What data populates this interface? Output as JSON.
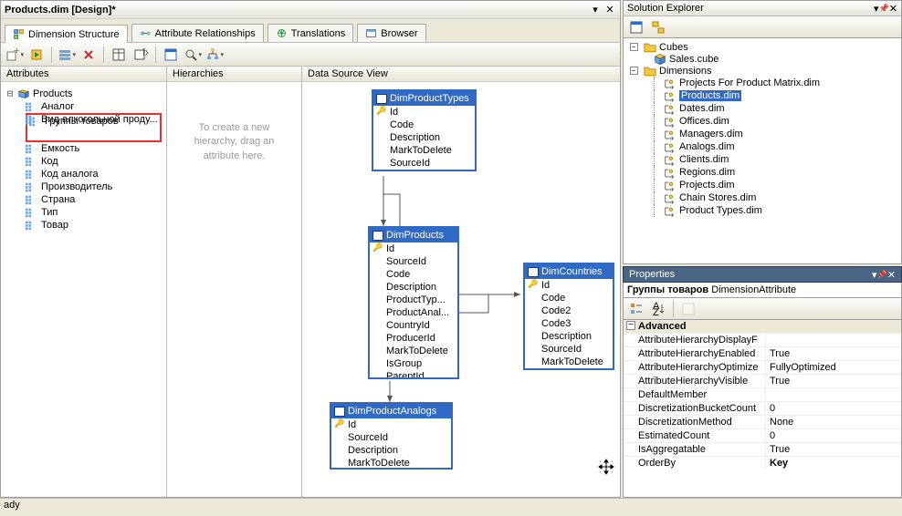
{
  "title": "Products.dim [Design]*",
  "tabs": [
    {
      "label": "Dimension Structure"
    },
    {
      "label": "Attribute Relationships"
    },
    {
      "label": "Translations"
    },
    {
      "label": "Browser"
    }
  ],
  "panes": {
    "attributes": "Attributes",
    "hierarchies": "Hierarchies",
    "dsv": "Data Source View"
  },
  "attr_root": "Products",
  "attributes": [
    "Аналог",
    "Вид алкогольной проду...",
    "Группы товаров",
    "Емкость",
    "Код",
    "Код аналога",
    "Производитель",
    "Страна",
    "Тип",
    "Товар"
  ],
  "hier_hint": "To create a new hierarchy, drag an attribute here.",
  "dsv_tables": {
    "DimProductTypes": {
      "name": "DimProductTypes",
      "cols": [
        "Id",
        "Code",
        "Description",
        "MarkToDelete",
        "SourceId"
      ]
    },
    "DimProducts": {
      "name": "DimProducts",
      "cols": [
        "Id",
        "SourceId",
        "Code",
        "Description",
        "ProductTyp...",
        "ProductAnal...",
        "CountryId",
        "ProducerId",
        "MarkToDelete",
        "IsGroup",
        "ParentId"
      ]
    },
    "DimCountries": {
      "name": "DimCountries",
      "cols": [
        "Id",
        "Code",
        "Code2",
        "Code3",
        "Description",
        "SourceId",
        "MarkToDelete"
      ]
    },
    "DimProductAnalogs": {
      "name": "DimProductAnalogs",
      "cols": [
        "Id",
        "SourceId",
        "Description",
        "MarkToDelete"
      ]
    }
  },
  "solution_explorer": {
    "title": "Solution Explorer",
    "cubes": "Cubes",
    "sales_cube": "Sales.cube",
    "dimensions": "Dimensions",
    "dims": [
      "Projects For Product Matrix.dim",
      "Products.dim",
      "Dates.dim",
      "Offices.dim",
      "Managers.dim",
      "Analogs.dim",
      "Clients.dim",
      "Regions.dim",
      "Projects.dim",
      "Chain Stores.dim",
      "Product Types.dim"
    ]
  },
  "properties": {
    "title": "Properties",
    "object_name": "Группы товаров",
    "object_type": "DimensionAttribute",
    "category": "Advanced",
    "rows": [
      {
        "name": "AttributeHierarchyDisplayF",
        "val": ""
      },
      {
        "name": "AttributeHierarchyEnabled",
        "val": "True"
      },
      {
        "name": "AttributeHierarchyOptimize",
        "val": "FullyOptimized"
      },
      {
        "name": "AttributeHierarchyVisible",
        "val": "True"
      },
      {
        "name": "DefaultMember",
        "val": ""
      },
      {
        "name": "DiscretizationBucketCount",
        "val": "0"
      },
      {
        "name": "DiscretizationMethod",
        "val": "None"
      },
      {
        "name": "EstimatedCount",
        "val": "0"
      },
      {
        "name": "IsAggregatable",
        "val": "True"
      },
      {
        "name": "OrderBy",
        "val": "Key",
        "bold": true
      }
    ]
  },
  "status": "ady"
}
